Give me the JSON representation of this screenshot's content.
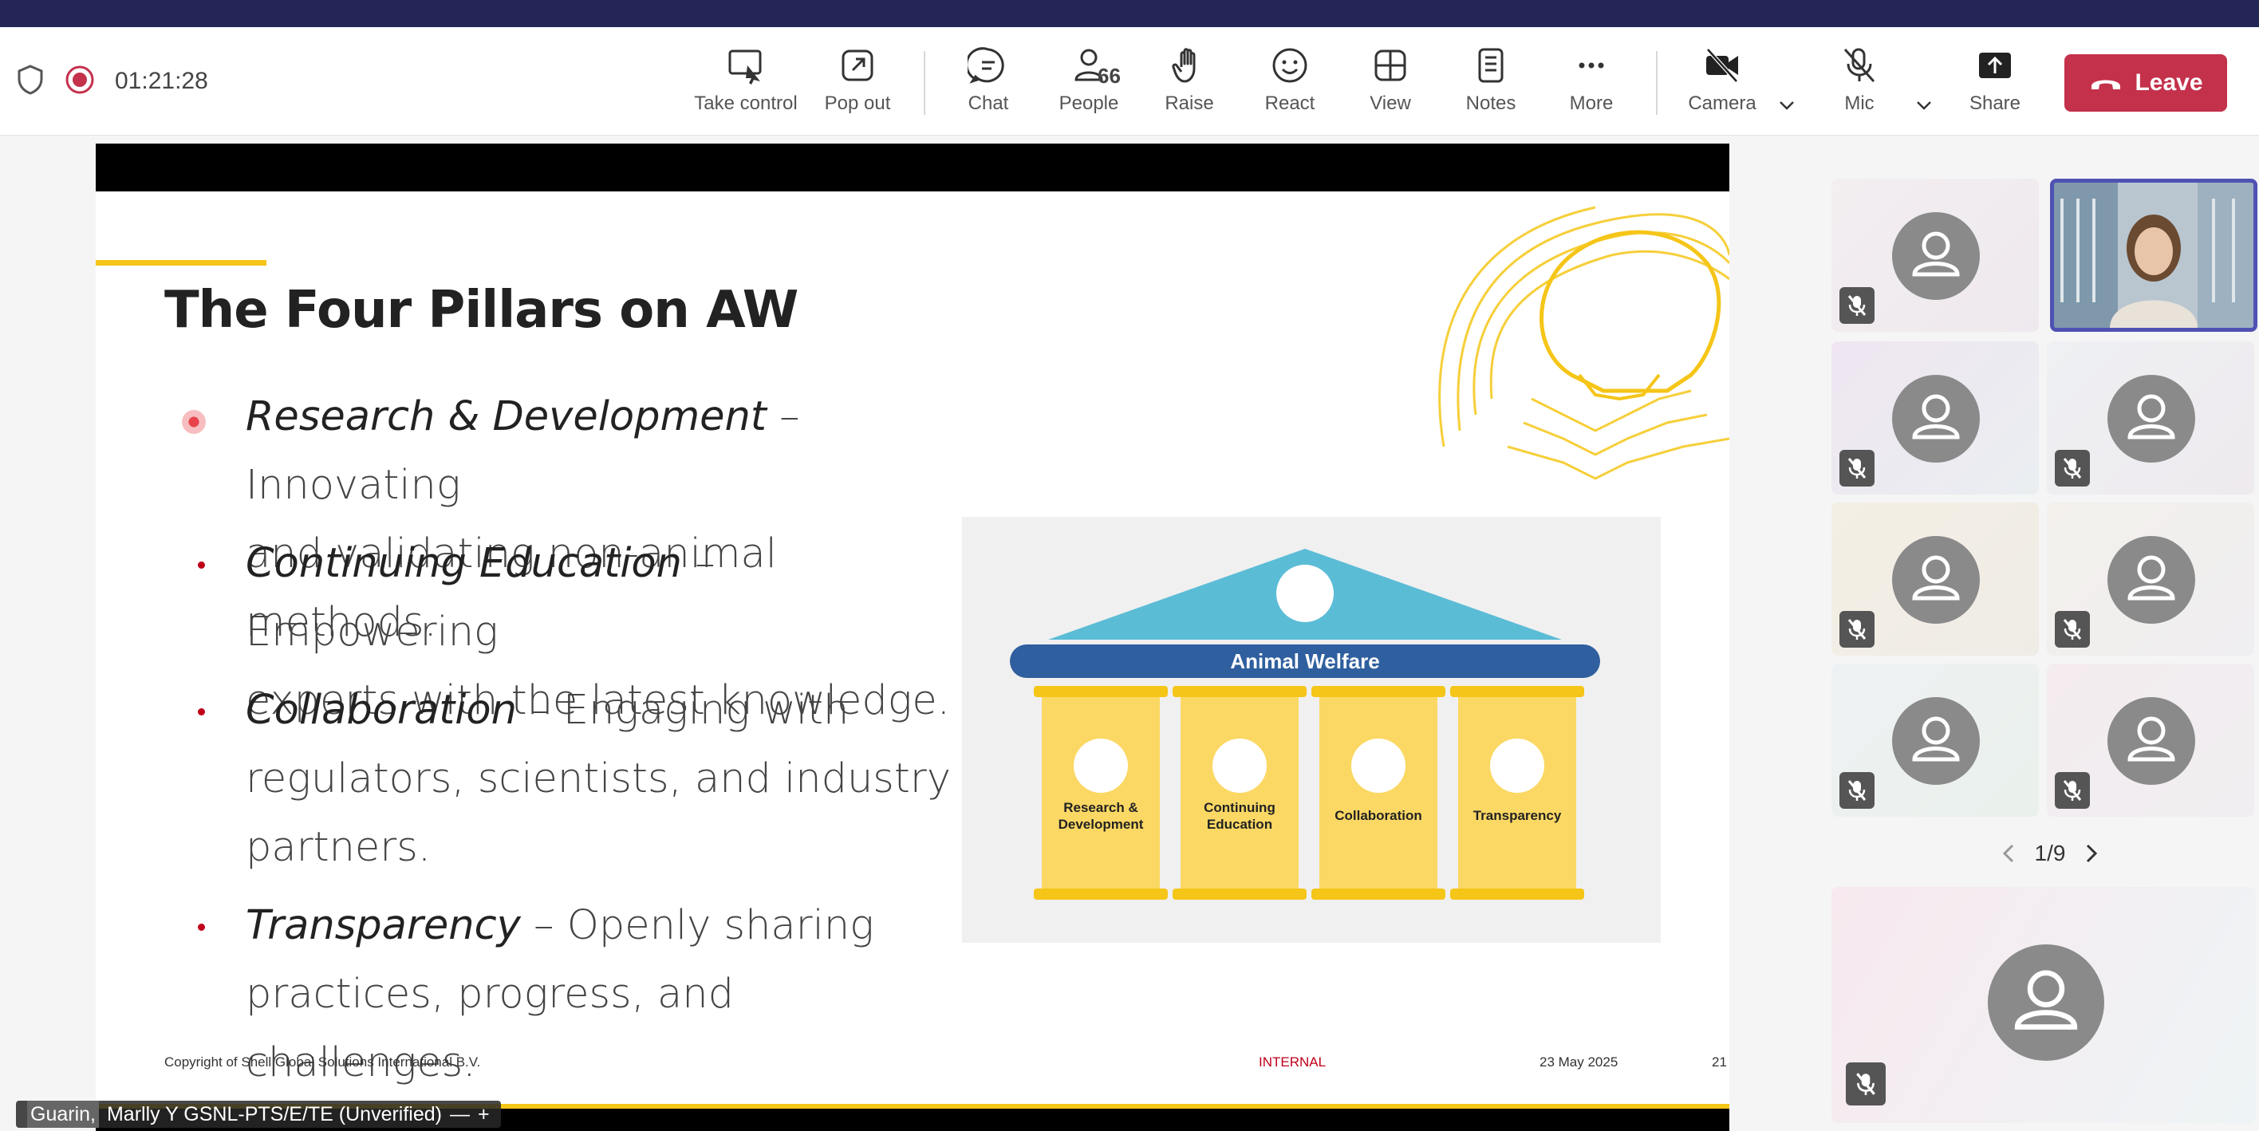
{
  "meeting": {
    "timer": "01:21:28",
    "people_count": "66",
    "toolbar": {
      "take_control": "Take control",
      "pop_out": "Pop out",
      "chat": "Chat",
      "people": "People",
      "raise": "Raise",
      "react": "React",
      "view": "View",
      "notes": "Notes",
      "more": "More",
      "camera": "Camera",
      "mic": "Mic",
      "share": "Share",
      "leave": "Leave"
    },
    "presenter_name_highlight": "Guarin,",
    "presenter_name_rest": "Marlly Y GSNL-PTS/E/TE (Unverified)",
    "name_tag_minus": "—",
    "name_tag_plus": "+",
    "gallery_page": "1/9",
    "colors": {
      "leave": "#c4314b",
      "topstrip": "#232656",
      "active_tile_border": "#4f52b2"
    }
  },
  "slide": {
    "title": "The Four Pillars on AW",
    "bullets": [
      {
        "term": "Research & Development",
        "desc_line1": " – Innovating",
        "desc_line2": "and validating non-animal methods."
      },
      {
        "term": "Continuing Education",
        "desc_line1": " – Empowering",
        "desc_line2": "experts with the latest knowledge."
      },
      {
        "term": "Collaboration",
        "desc_line1": " – Engaging with",
        "desc_line2": "regulators, scientists, and industry",
        "desc_line3": "partners."
      },
      {
        "term": "Transparency",
        "desc_line1": " – Openly sharing",
        "desc_line2": "practices, progress, and challenges."
      }
    ],
    "diagram": {
      "roof_label": "Animal Welfare",
      "pillars": [
        {
          "line1": "Research &",
          "line2": "Development"
        },
        {
          "line1": "Continuing",
          "line2": "Education"
        },
        {
          "line1": "Collaboration",
          "line2": ""
        },
        {
          "line1": "Transparency",
          "line2": ""
        }
      ],
      "colors": {
        "roof": "#5bbcd6",
        "beam": "#2f5f9e",
        "pillar": "#fbd864",
        "pillar_cap": "#f5c518"
      }
    },
    "footer": {
      "copyright": "Copyright of Shell Global Solutions International B.V.",
      "classification": "INTERNAL",
      "date": "23 May 2025",
      "page": "21"
    }
  }
}
